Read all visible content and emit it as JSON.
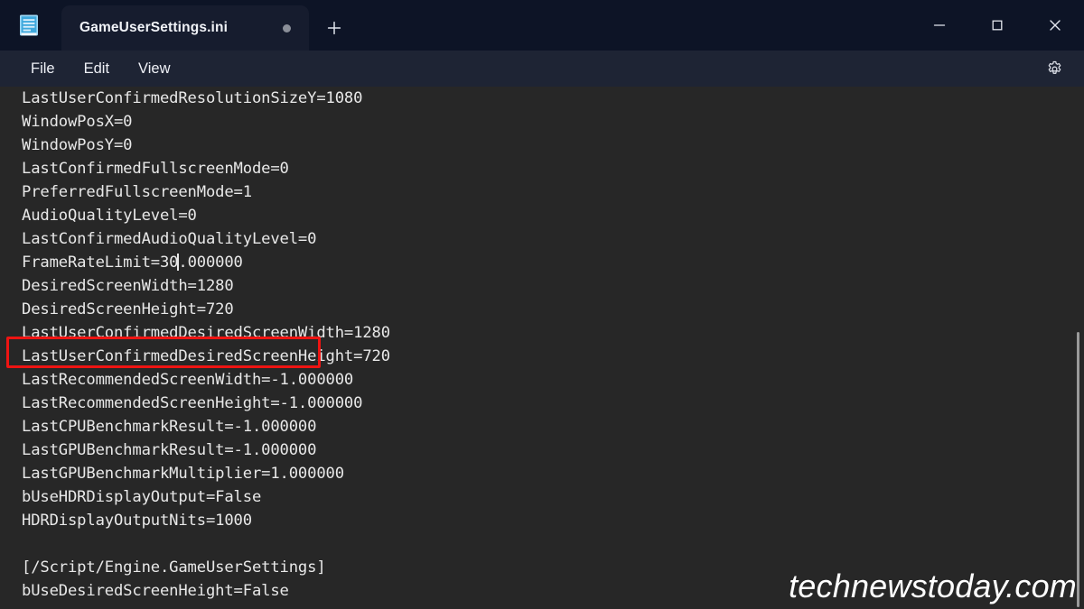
{
  "window": {
    "app_icon": "notepad-icon",
    "controls": {
      "minimize": "—",
      "maximize": "☐",
      "close": "✕"
    }
  },
  "tabbar": {
    "tabs": [
      {
        "title": "GameUserSettings.ini",
        "modified": true
      }
    ],
    "new_tab_label": "+"
  },
  "menubar": {
    "items": [
      {
        "label": "File"
      },
      {
        "label": "Edit"
      },
      {
        "label": "View"
      }
    ],
    "settings_icon": "gear-icon"
  },
  "editor": {
    "lines": [
      "LastUserConfirmedResolutionSizeY=1080",
      "WindowPosX=0",
      "WindowPosY=0",
      "LastConfirmedFullscreenMode=0",
      "PreferredFullscreenMode=1",
      "AudioQualityLevel=0",
      "LastConfirmedAudioQualityLevel=0",
      "FrameRateLimit=30.000000",
      "DesiredScreenWidth=1280",
      "DesiredScreenHeight=720",
      "LastUserConfirmedDesiredScreenWidth=1280",
      "LastUserConfirmedDesiredScreenHeight=720",
      "LastRecommendedScreenWidth=-1.000000",
      "LastRecommendedScreenHeight=-1.000000",
      "LastCPUBenchmarkResult=-1.000000",
      "LastGPUBenchmarkResult=-1.000000",
      "LastGPUBenchmarkMultiplier=1.000000",
      "bUseHDRDisplayOutput=False",
      "HDRDisplayOutputNits=1000",
      "",
      "[/Script/Engine.GameUserSettings]",
      "bUseDesiredScreenHeight=False"
    ],
    "caret_line_index": 7,
    "caret_text_before": "FrameRateLimit=30",
    "caret_text_after": ".000000"
  },
  "annotation": {
    "type": "rectangle-highlight",
    "color": "#ee1412",
    "target_text": "FrameRateLimit=30.000000"
  },
  "watermark": {
    "text": "technewstoday.com"
  },
  "colors": {
    "titlebar_bg": "#0d1426",
    "tab_bg": "#161c2e",
    "menubar_bg": "#1e2434",
    "editor_bg": "#272727",
    "text_fg": "#e8e8e8",
    "annotation_red": "#ee1412"
  }
}
